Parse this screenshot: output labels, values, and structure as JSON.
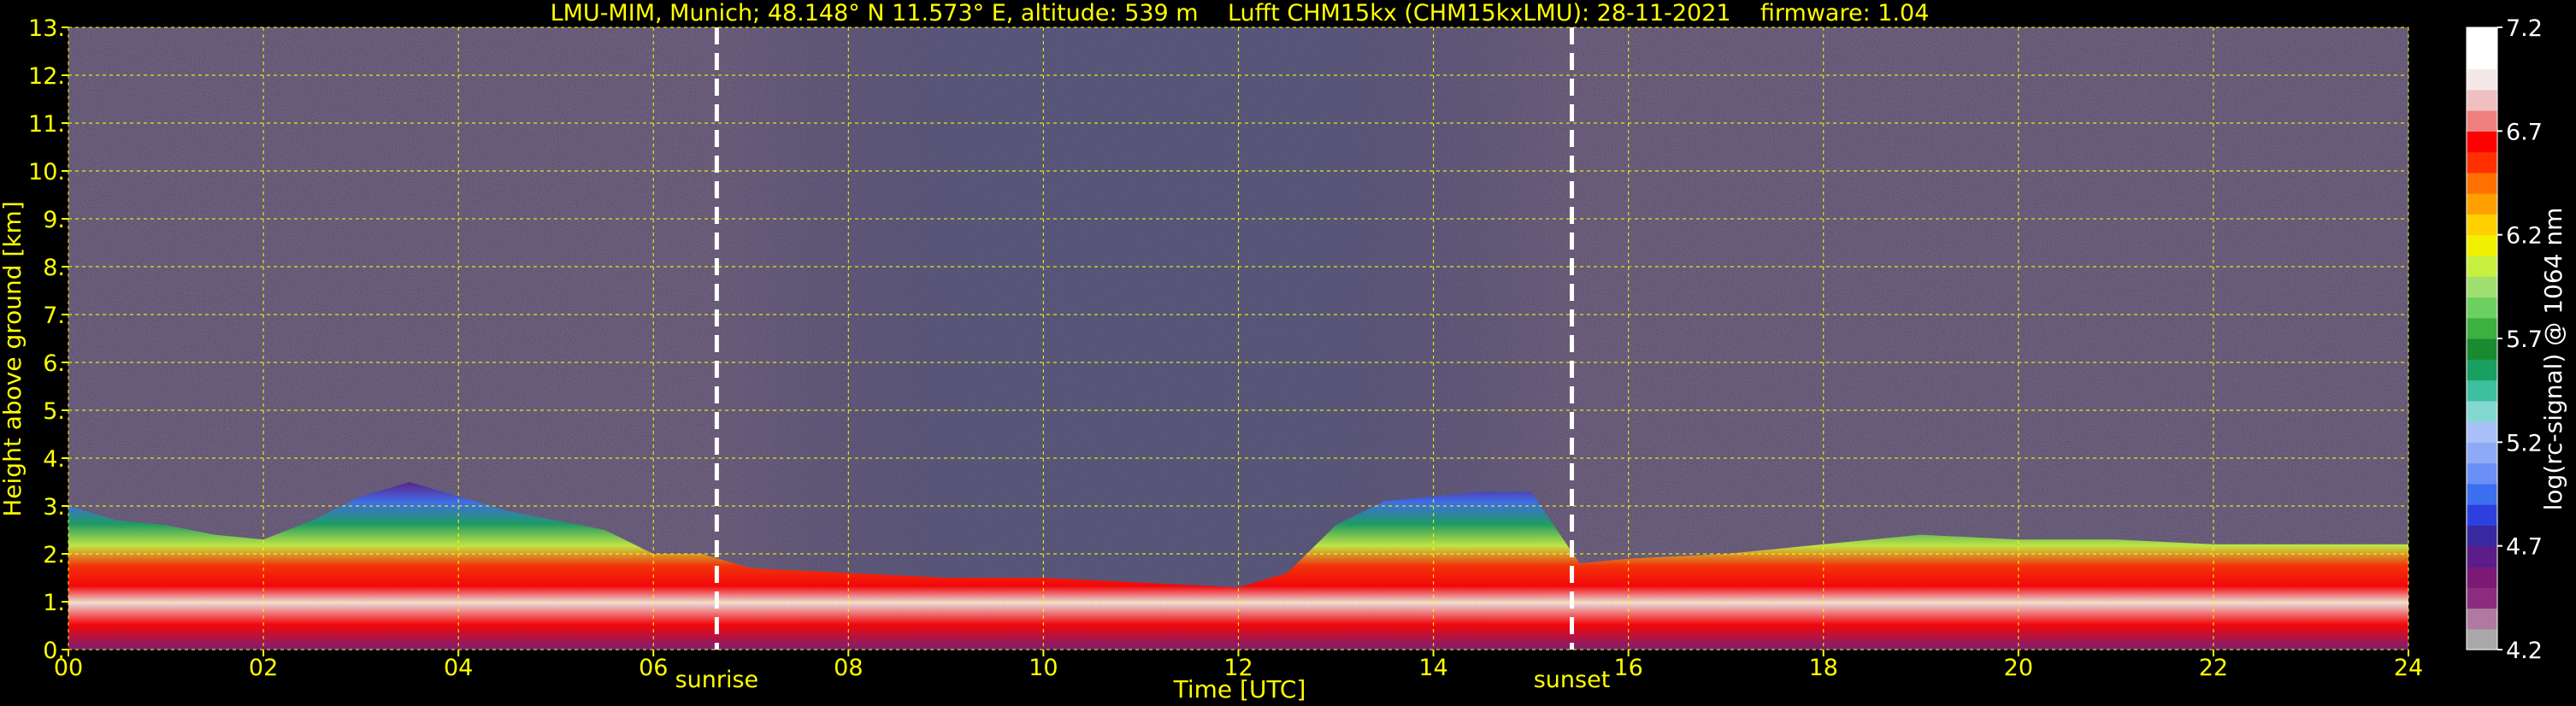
{
  "title": "LMU-MIM, Munich; 48.148° N 11.573° E, altitude: 539 m    Lufft CHM15kx (CHM15kxLMU): 28-11-2021    firmware: 1.04",
  "colors": {
    "background": "#000000",
    "axis_text": "#ffff00",
    "grid": "#ffff00",
    "colorbar_text": "#ffffff"
  },
  "chart_data": {
    "type": "heatmap",
    "title": "LMU-MIM, Munich; 48.148° N 11.573° E, altitude: 539 m    Lufft CHM15kx (CHM15kxLMU): 28-11-2021    firmware: 1.04",
    "xlabel": "Time [UTC]",
    "ylabel": "Height above ground [km]",
    "xlim": [
      0,
      24
    ],
    "ylim": [
      0,
      13
    ],
    "x_ticks": [
      0,
      2,
      4,
      6,
      8,
      10,
      12,
      14,
      16,
      18,
      20,
      22,
      24
    ],
    "x_tick_labels": [
      "00",
      "02",
      "04",
      "06",
      "08",
      "10",
      "12",
      "14",
      "16",
      "18",
      "20",
      "22",
      "24"
    ],
    "y_ticks": [
      0,
      1,
      2,
      3,
      4,
      5,
      6,
      7,
      8,
      9,
      10,
      11,
      12,
      13
    ],
    "y_tick_labels": [
      "0.",
      "1.",
      "2.",
      "3.",
      "4.",
      "5.",
      "6.",
      "7.",
      "8.",
      "9.",
      "10.",
      "11.",
      "12.",
      "13."
    ],
    "grid": true,
    "colorbar": {
      "label": "log(rc-signal) @ 1064 nm",
      "range": [
        4.2,
        7.2
      ],
      "ticks": [
        4.2,
        4.7,
        5.2,
        5.7,
        6.2,
        6.7,
        7.2
      ],
      "tick_labels": [
        "4.2",
        "4.7",
        "5.2",
        "5.7",
        "6.2",
        "6.7",
        "7.2"
      ],
      "colors": [
        "#a9a9a9",
        "#b07aa0",
        "#8b2c7e",
        "#7a1a75",
        "#5a1d8a",
        "#3a28a0",
        "#2e3fe0",
        "#3c6ef0",
        "#6a90f5",
        "#8eaaf7",
        "#aac0f8",
        "#84d8d0",
        "#3cc0a0",
        "#19a060",
        "#1a8a30",
        "#3cb040",
        "#6cd060",
        "#a0e070",
        "#c8f040",
        "#f0f000",
        "#ffd000",
        "#ffa000",
        "#ff7000",
        "#ff3000",
        "#ff0000",
        "#f08080",
        "#f0c0c0",
        "#f5e8e8",
        "#ffffff",
        "#ffffff"
      ]
    },
    "markers": [
      {
        "label": "sunrise",
        "x": 6.65
      },
      {
        "label": "sunset",
        "x": 15.42
      }
    ],
    "aerosol_layer_top_km": {
      "x": [
        0,
        0.5,
        1,
        1.5,
        2,
        2.5,
        3,
        3.5,
        4,
        4.5,
        5,
        5.5,
        6,
        6.5,
        7,
        8,
        9,
        10,
        11,
        12,
        12.5,
        13,
        13.5,
        14,
        14.5,
        15,
        15.5,
        16,
        17,
        18,
        19,
        20,
        21,
        22,
        23,
        24
      ],
      "y": [
        3.0,
        2.7,
        2.6,
        2.4,
        2.3,
        2.7,
        3.2,
        3.5,
        3.2,
        2.9,
        2.7,
        2.5,
        2.0,
        2.0,
        1.7,
        1.6,
        1.5,
        1.5,
        1.4,
        1.3,
        1.6,
        2.6,
        3.1,
        3.2,
        3.3,
        3.3,
        1.8,
        1.9,
        2.0,
        2.2,
        2.4,
        2.3,
        2.3,
        2.2,
        2.2,
        2.2
      ]
    }
  }
}
